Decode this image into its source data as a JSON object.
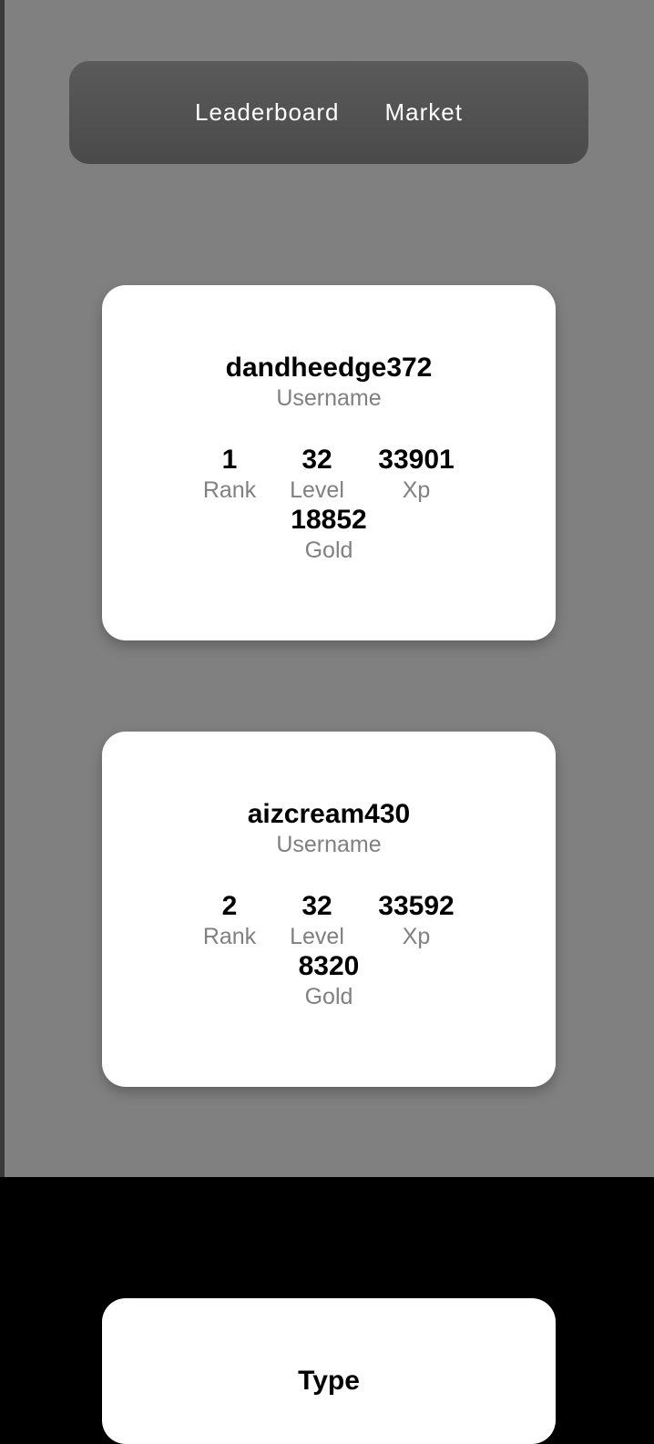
{
  "nav": {
    "items": [
      {
        "label": "Leaderboard"
      },
      {
        "label": "Market"
      }
    ]
  },
  "leaderboard": [
    {
      "username": "dandheedge372",
      "username_label": "Username",
      "rank": "1",
      "rank_label": "Rank",
      "level": "32",
      "level_label": "Level",
      "xp": "33901",
      "xp_label": "Xp",
      "gold": "18852",
      "gold_label": "Gold"
    },
    {
      "username": "aizcream430",
      "username_label": "Username",
      "rank": "2",
      "rank_label": "Rank",
      "level": "32",
      "level_label": "Level",
      "xp": "33592",
      "xp_label": "Xp",
      "gold": "8320",
      "gold_label": "Gold"
    }
  ],
  "market": {
    "type_title": "Type"
  },
  "colors": {
    "page_background": "#808080",
    "navbar": "#505050",
    "card": "#ffffff",
    "label": "#808080",
    "lower_section": "#000000"
  }
}
